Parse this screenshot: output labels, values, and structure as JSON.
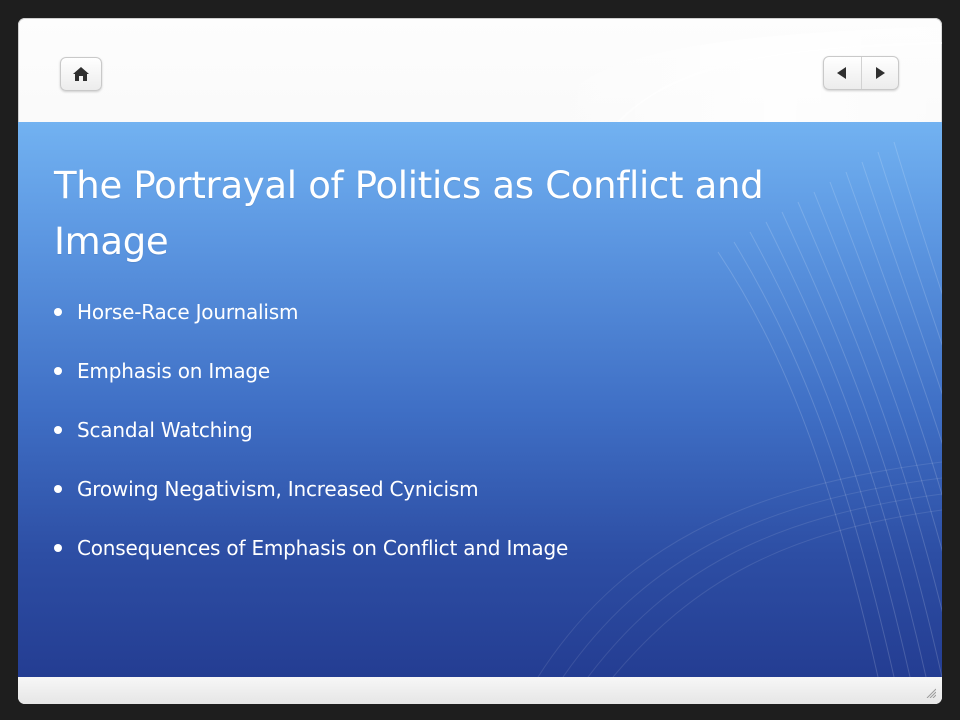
{
  "top_bar": {
    "home_icon": "home-icon",
    "prev_icon": "left-triangle-icon",
    "next_icon": "right-triangle-icon"
  },
  "slide": {
    "title": "The Portrayal of Politics as Conflict and Image",
    "bullets": [
      {
        "text": "Horse-Race Journalism"
      },
      {
        "text": "Emphasis on Image"
      },
      {
        "text": "Scandal Watching"
      },
      {
        "text": "Growing Negativism, Increased Cynicism"
      },
      {
        "text": "Consequences of Emphasis on Conflict and Image"
      }
    ]
  },
  "colors": {
    "background": "#1e1e1e",
    "frame": "#f2f2f2",
    "slide_top": "#72b2f1",
    "slide_bottom": "#243d92",
    "text": "#ffffff",
    "icon": "#2f2f2f"
  },
  "bottom_bar": {
    "grip_icon": "resize-grip-icon"
  }
}
